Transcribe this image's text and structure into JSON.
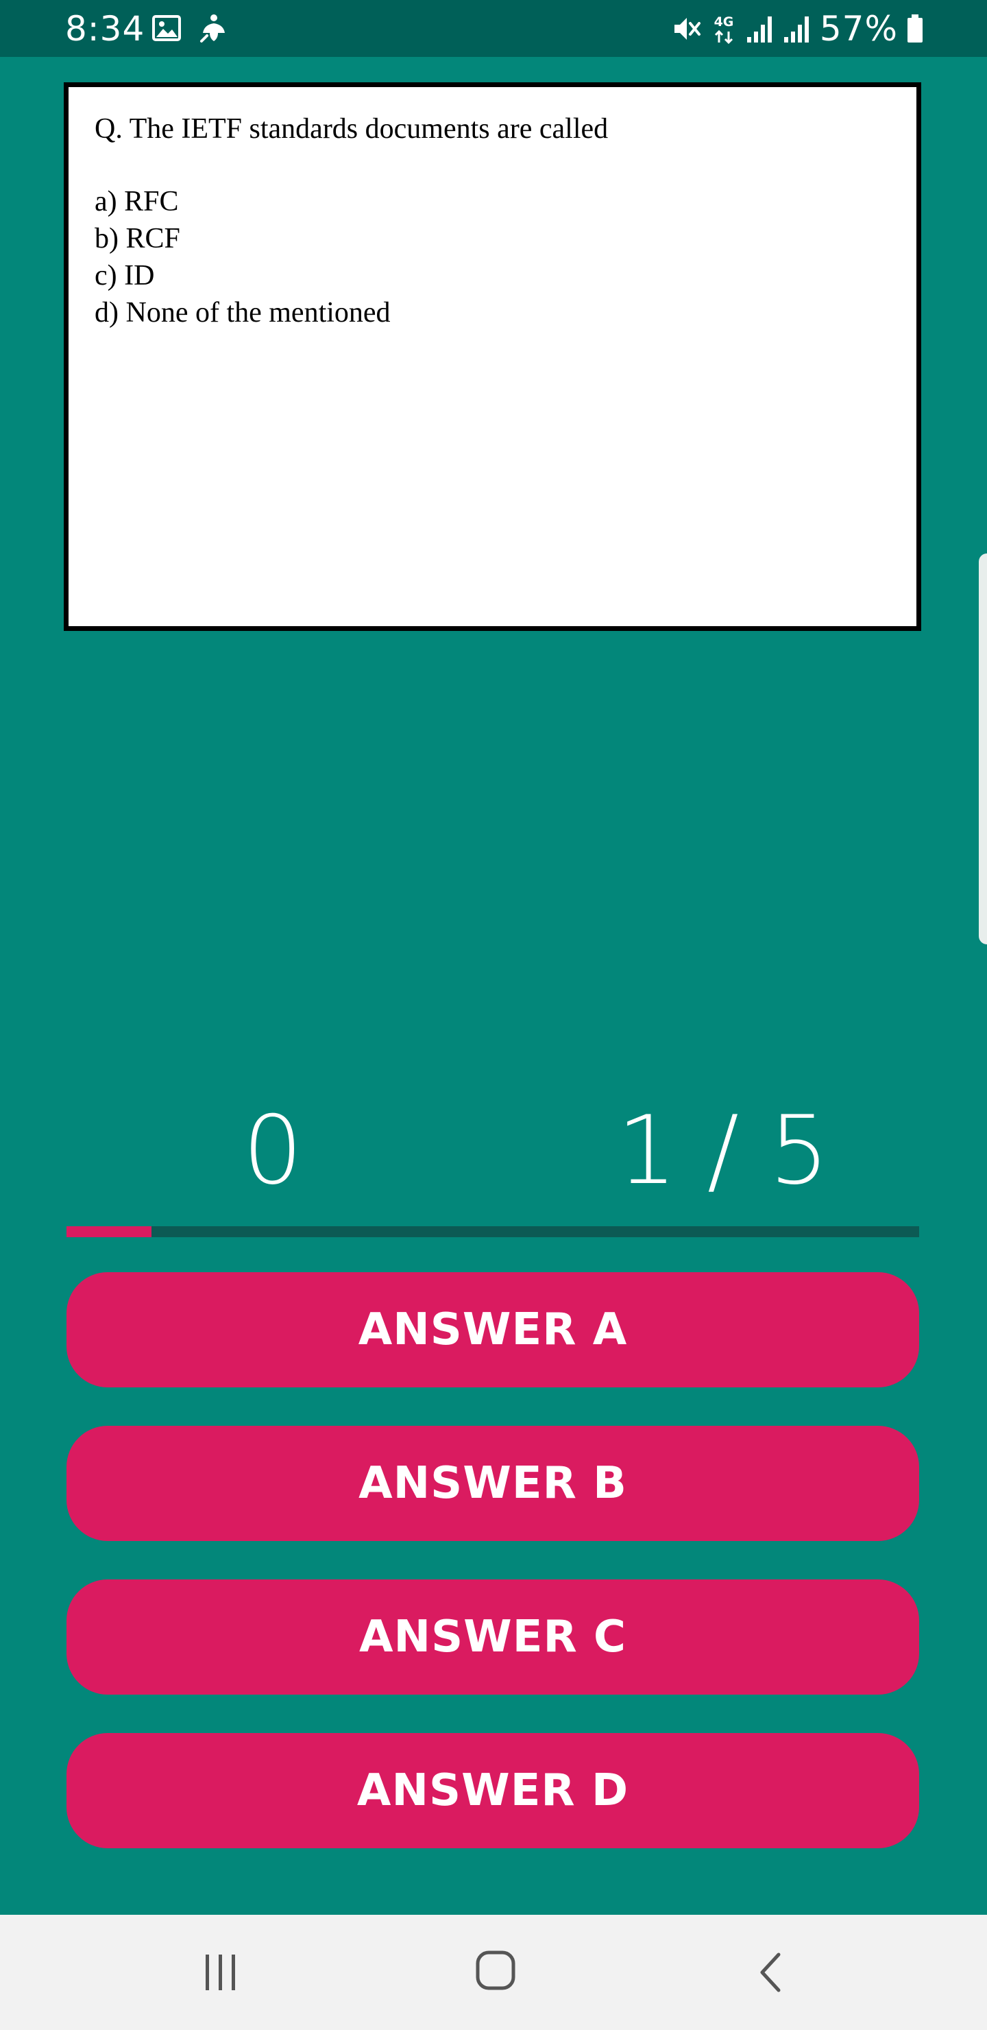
{
  "status_bar": {
    "time": "8:34",
    "battery": "57%",
    "network": "4G",
    "icons": [
      "gallery-icon",
      "notification-icon",
      "mute-icon",
      "4g-icon",
      "signal-icon",
      "signal-icon",
      "battery-icon"
    ]
  },
  "question": {
    "text": "Q. The IETF standards documents are called",
    "options": [
      "a) RFC",
      "b) RCF",
      "c) ID",
      "d) None of the mentioned"
    ]
  },
  "score": "0",
  "progress": {
    "label": "1 / 5",
    "fraction": 0.1
  },
  "answers": {
    "a": "ANSWER A",
    "b": "ANSWER B",
    "c": "ANSWER C",
    "d": "ANSWER D"
  },
  "nav": {
    "icons": [
      "recent-apps-icon",
      "home-icon",
      "back-icon"
    ]
  },
  "colors": {
    "background": "#03877A",
    "status_bar": "#006058",
    "accent": "#DA1B60",
    "progress_track": "#0C5A54",
    "nav_bar": "#F2F2F2"
  }
}
